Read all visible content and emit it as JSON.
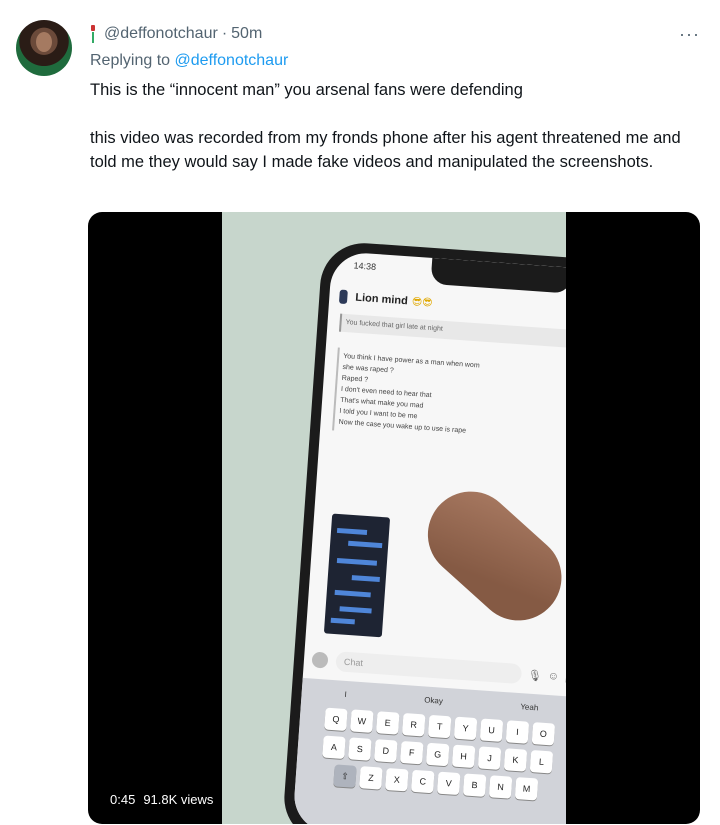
{
  "tweet": {
    "handle": "@deffonotchaur",
    "separator": "·",
    "time": "50m",
    "more_label": "···",
    "reply_prefix": "Replying to",
    "reply_mention": "@deffonotchaur",
    "paragraphs": [
      "This is the “innocent man” you arsenal fans were defending",
      "this video was recorded from my fronds phone after his agent threatened me and told me they would say I made fake videos and manipulated the screenshots."
    ]
  },
  "video": {
    "duration": "0:45",
    "views": "91.8K views",
    "phone": {
      "status_time": "14:38",
      "contact_name": "Lion mind",
      "contact_emoji": "😎😎",
      "quoted_text": "You fucked that girl late at night",
      "message_lines": [
        "You think I have power as a man when wom",
        "she was raped ?",
        "Raped ?",
        "I don't even need to hear that",
        "That's what make you mad",
        "I told you I want to be me",
        "Now the case you wake up to use is rape"
      ],
      "chat_placeholder": "Chat",
      "suggestions": [
        "I",
        "Okay",
        "Yeah"
      ],
      "keyboard_rows": [
        [
          "Q",
          "W",
          "E",
          "R",
          "T",
          "Y",
          "U",
          "I",
          "O"
        ],
        [
          "A",
          "S",
          "D",
          "F",
          "G",
          "H",
          "J",
          "K",
          "L"
        ],
        [
          "⇧",
          "Z",
          "X",
          "C",
          "V",
          "B",
          "N",
          "M"
        ]
      ]
    }
  },
  "icons": {
    "avatar": "profile-photo",
    "more": "more-horizontal-icon",
    "contact_glasses": "sunglasses-emoji-icon"
  },
  "colors": {
    "text": "#0f1419",
    "secondary": "#536471",
    "link": "#1d9bf0",
    "video_bg": "#000000"
  }
}
